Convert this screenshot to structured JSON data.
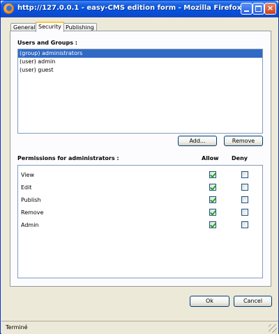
{
  "window": {
    "title": "http://127.0.0.1 - easy-CMS edition form - Mozilla Firefox"
  },
  "tabs": [
    {
      "label": "General",
      "active": false
    },
    {
      "label": "Security",
      "active": true
    },
    {
      "label": "Publishing",
      "active": false
    }
  ],
  "users_section": {
    "label": "Users and Groups :",
    "items": [
      {
        "label": "(group) administrators",
        "selected": true
      },
      {
        "label": "(user) admin",
        "selected": false
      },
      {
        "label": "(user) guest",
        "selected": false
      }
    ],
    "add_label": "Add...",
    "remove_label": "Remove"
  },
  "permissions_section": {
    "label": "Permissions for administrators :",
    "allow_header": "Allow",
    "deny_header": "Deny",
    "rows": [
      {
        "label": "View",
        "allow": true,
        "deny": false
      },
      {
        "label": "Edit",
        "allow": true,
        "deny": false
      },
      {
        "label": "Publish",
        "allow": true,
        "deny": false
      },
      {
        "label": "Remove",
        "allow": true,
        "deny": false
      },
      {
        "label": "Admin",
        "allow": true,
        "deny": false
      }
    ]
  },
  "footer": {
    "ok_label": "Ok",
    "cancel_label": "Cancel"
  },
  "status": {
    "text": "Terminé"
  },
  "colors": {
    "titlebar": "#0554e3",
    "selection": "#316ac5",
    "checkmark": "#21a121"
  }
}
